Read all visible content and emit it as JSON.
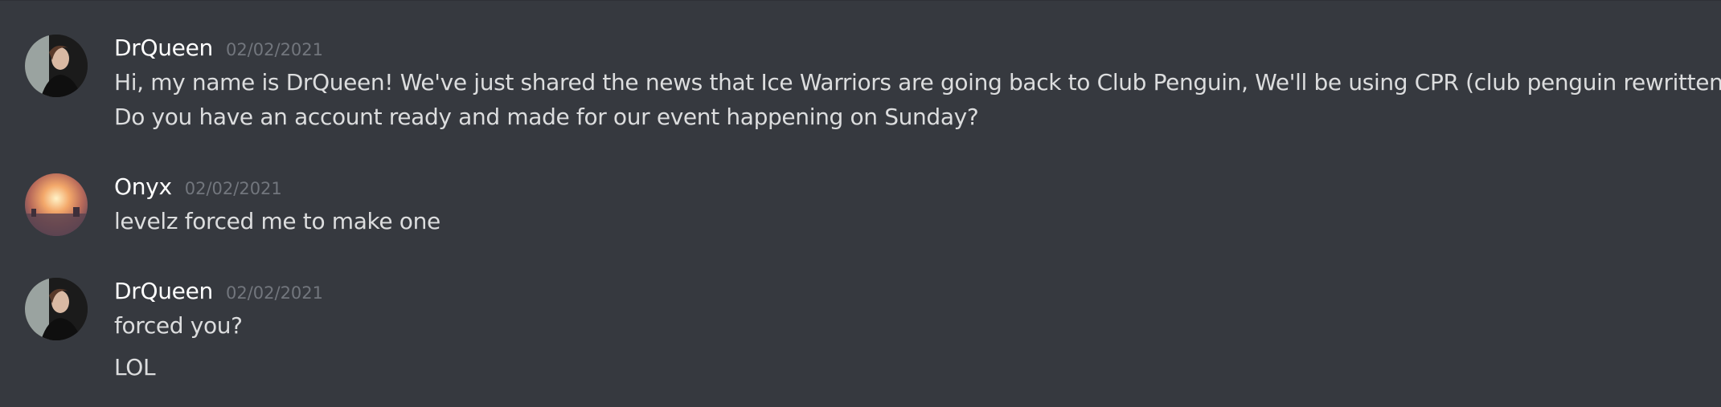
{
  "messages": [
    {
      "author": "DrQueen",
      "timestamp": "02/02/2021",
      "lines": [
        "Hi, my name is DrQueen! We've just shared the news that Ice Warriors are going back to Club Penguin, We'll be using CPR (club penguin rewritten)",
        "Do you have an account ready and made for our event happening on Sunday?"
      ]
    },
    {
      "author": "Onyx",
      "timestamp": "02/02/2021",
      "lines": [
        "levelz forced me to make one"
      ]
    },
    {
      "author": "DrQueen",
      "timestamp": "02/02/2021",
      "lines": [
        "forced you?",
        "LOL"
      ]
    }
  ],
  "colors": {
    "background": "#36393f",
    "username": "#ffffff",
    "timestamp": "#72767d",
    "message_text": "#dcddde"
  }
}
